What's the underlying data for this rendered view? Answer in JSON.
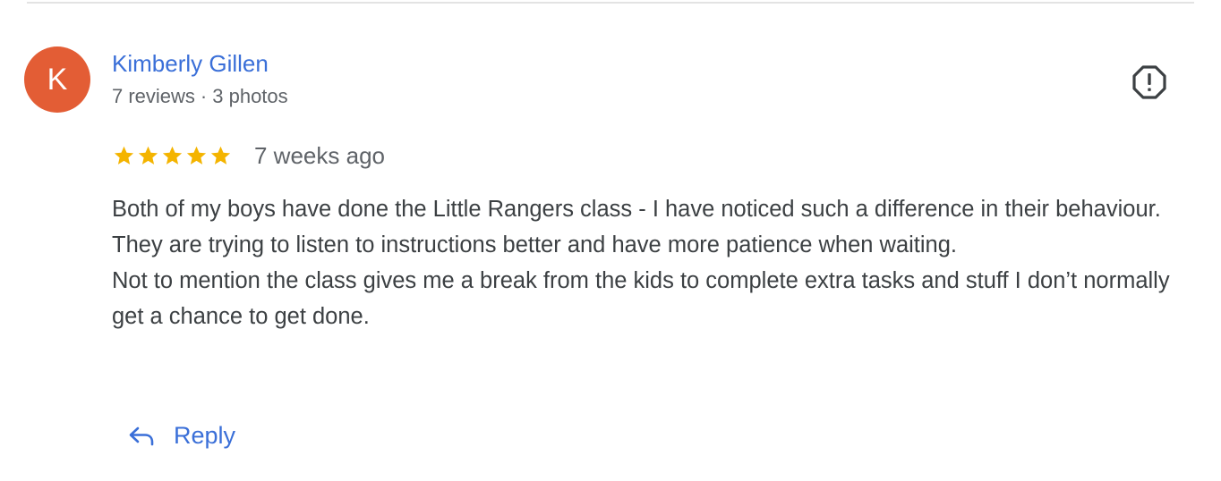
{
  "reviewer": {
    "initial": "K",
    "name": "Kimberly Gillen",
    "reviews": "7 reviews",
    "separator": "·",
    "photos": "3 photos",
    "avatar_color": "#e35d35"
  },
  "review": {
    "rating": 5,
    "max_rating": 5,
    "age": "7 weeks ago",
    "lines": [
      "Both of my boys have done the Little Rangers class - I have noticed such a difference in their behaviour.",
      "They are trying to listen to instructions better and have more patience when waiting.",
      "Not to mention the class gives me a break from the kids to complete extra tasks and stuff I don’t normally get a chance to get done."
    ]
  },
  "actions": {
    "reply_label": "Reply",
    "reply_icon": "reply-arrow-icon",
    "flag_icon": "report-flag-icon"
  },
  "colors": {
    "link": "#3a6fd8",
    "star": "#f4b400",
    "text": "#3c4043",
    "muted": "#5f6368"
  }
}
